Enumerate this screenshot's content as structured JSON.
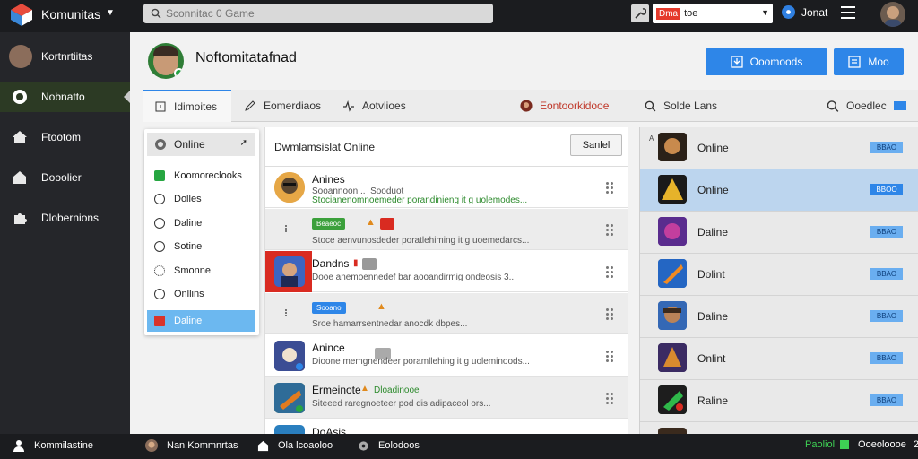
{
  "app": {
    "name": "Komunitas",
    "search_placeholder": "Sconnitac 0 Game"
  },
  "topbar": {
    "region_flag": "Dma",
    "region_label": "toe",
    "user_label": "Jonat"
  },
  "sidebar": {
    "items": [
      {
        "label": "Kortnrtiitas"
      },
      {
        "label": "Nobnatto"
      },
      {
        "label": "Ftootom"
      },
      {
        "label": "Dooolier"
      },
      {
        "label": "Dlobernions"
      }
    ]
  },
  "profile": {
    "name": "Noftomitatafnad",
    "buttons": [
      "Ooomoods",
      "Moo"
    ]
  },
  "tabs": [
    {
      "label": "Idimoites"
    },
    {
      "label": "Eomerdiaos"
    },
    {
      "label": "Aotvlioes"
    },
    {
      "label": "Eontoorkidooe"
    },
    {
      "label": "Solde Lans"
    },
    {
      "label": "Ooedlec"
    }
  ],
  "status_menu": {
    "current": "Online",
    "options": [
      "Koomoreclooks",
      "Dolles",
      "Daline",
      "Sotine",
      "Smonne",
      "Onllins",
      "Daline"
    ]
  },
  "friend_list": {
    "title": "Dwmlamsislat Online",
    "search_label": "Sanlel",
    "rows": [
      {
        "name": "Anines",
        "status": "Sooannoon...",
        "status2": "Sooduot",
        "text": "Stocianenomnoemeder porandinieng it g uolemodes..."
      },
      {
        "name": "",
        "pill1": "Beaeoc",
        "text": "Stoce aenvunosdeder poratlehiming it g uoemedarcs..."
      },
      {
        "name": "Dandns",
        "pill1": "",
        "text": "Dooe anemoennedef bar aooandirmig ondeosis 3..."
      },
      {
        "name": "",
        "pill1": "Sooano",
        "text": "Sroe hamarrsentnedar anocdk dbpes..."
      },
      {
        "name": "Anince",
        "text": "Dioone memgnendeer poramllehing it g uoleminoods..."
      },
      {
        "name": "Ermeinote",
        "pill1": "Dloadinooe",
        "text": "Siteeed raregnoeteer pod dis adipaceol ors..."
      },
      {
        "name": "DoAsis",
        "text": ""
      }
    ]
  },
  "games": [
    {
      "idx": "A",
      "name": "Online",
      "btn": "BBAO"
    },
    {
      "idx": "",
      "name": "Online",
      "btn": "BBOO"
    },
    {
      "idx": "",
      "name": "Daline",
      "btn": "BBAO"
    },
    {
      "idx": "",
      "name": "Dolint",
      "btn": "BBAO"
    },
    {
      "idx": "",
      "name": "Daline",
      "btn": "BBAO"
    },
    {
      "idx": "",
      "name": "Onlint",
      "btn": "BBAO"
    },
    {
      "idx": "",
      "name": "Raline",
      "btn": "BBAO"
    }
  ],
  "bottombar": {
    "app_label": "Kommilastine",
    "user_label": "Nan Kommnrtas",
    "item3": "Ola lcoaoloo",
    "item4": "Eolodoos",
    "status": "Paoliol",
    "status_text": "Ooeoloooe",
    "count": "2"
  },
  "colors": {
    "accent": "#2e86e8",
    "online_green": "#26a641",
    "danger_red": "#d92b21"
  }
}
